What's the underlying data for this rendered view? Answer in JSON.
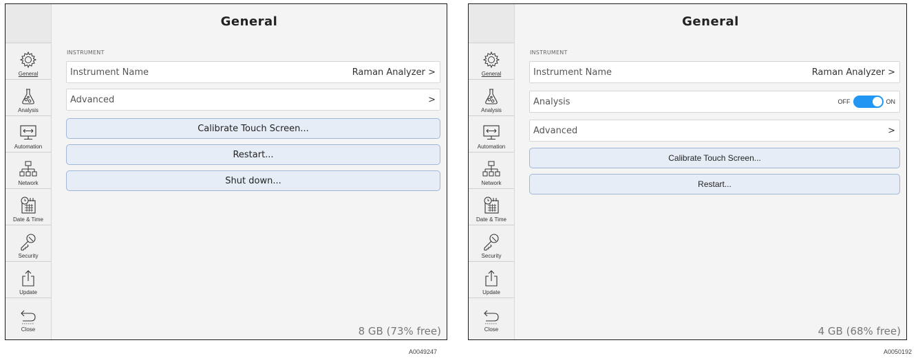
{
  "colors": {
    "accent": "#2196f3",
    "button_bg": "#e6edf7",
    "button_border": "#9fb6d6"
  },
  "sidebar": {
    "items": [
      {
        "label": "General",
        "icon": "gear-icon"
      },
      {
        "label": "Analysis",
        "icon": "flask-icon"
      },
      {
        "label": "Automation",
        "icon": "monitor-arrows-icon"
      },
      {
        "label": "Network",
        "icon": "network-icon"
      },
      {
        "label": "Date & Time",
        "icon": "calendar-clock-icon"
      },
      {
        "label": "Security",
        "icon": "key-icon"
      },
      {
        "label": "Update",
        "icon": "share-upload-icon"
      },
      {
        "label": "Close",
        "icon": "back-arrow-icon"
      }
    ]
  },
  "screen1": {
    "title": "General",
    "section_label": "INSTRUMENT",
    "instrument_name_label": "Instrument Name",
    "instrument_name_value": "Raman Analyzer >",
    "advanced_label": "Advanced",
    "advanced_chevron": ">",
    "calibrate_label": "Calibrate Touch Screen...",
    "restart_label": "Restart...",
    "shutdown_label": "Shut down...",
    "storage": "8 GB (73% free)",
    "caption": "A0049247"
  },
  "screen2": {
    "title": "General",
    "section_label": "INSTRUMENT",
    "instrument_name_label": "Instrument Name",
    "instrument_name_value": "Raman Analyzer >",
    "analysis_label": "Analysis",
    "toggle_off": "OFF",
    "toggle_on": "ON",
    "analysis_enabled": true,
    "advanced_label": "Advanced",
    "advanced_chevron": ">",
    "calibrate_label": "Calibrate Touch Screen...",
    "restart_label": "Restart...",
    "storage": "4 GB (68% free)",
    "caption": "A0050192"
  }
}
